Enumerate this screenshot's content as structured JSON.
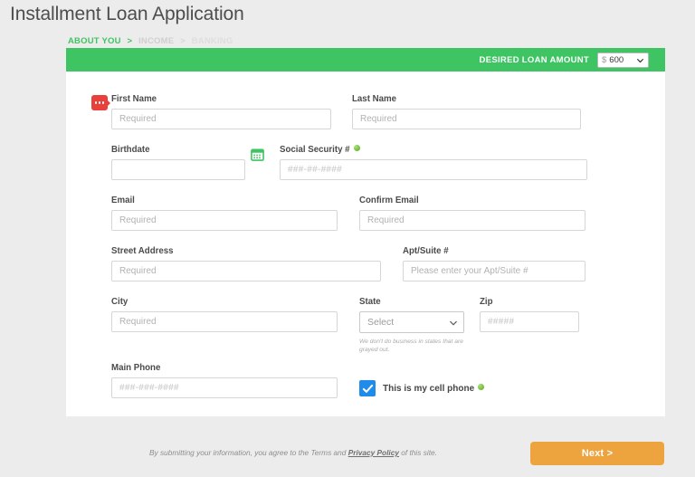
{
  "page": {
    "title": "Installment Loan Application",
    "background_color": "#ececec",
    "card_background": "#ffffff",
    "accent_green": "#3fc463",
    "accent_orange": "#eda43e",
    "accent_blue": "#1f8ceb",
    "accent_red": "#e8413c"
  },
  "breadcrumb": {
    "steps": [
      {
        "label": "ABOUT YOU",
        "state": "active"
      },
      {
        "label": "INCOME",
        "state": "inactive"
      },
      {
        "label": "BANKING",
        "state": "inactive"
      }
    ],
    "separator": ">"
  },
  "header_bar": {
    "label": "DESIRED LOAN AMOUNT",
    "amount_currency": "$",
    "amount_value": "600",
    "chevron_icon": "chevron-down-icon",
    "options": [
      "$ 600"
    ]
  },
  "form": {
    "first_name": {
      "label": "First Name",
      "placeholder": "Required",
      "value": "",
      "marker_icon": "required-tooltip-icon"
    },
    "last_name": {
      "label": "Last Name",
      "placeholder": "Required",
      "value": ""
    },
    "birthdate": {
      "label": "Birthdate",
      "placeholder": "",
      "value": "",
      "calendar_icon": "calendar-icon"
    },
    "social_security": {
      "label": "Social Security #",
      "placeholder": "###-##-####",
      "value": "",
      "help_icon": "help-dot-icon"
    },
    "email": {
      "label": "Email",
      "placeholder": "Required",
      "value": ""
    },
    "confirm_email": {
      "label": "Confirm Email",
      "placeholder": "Required",
      "value": ""
    },
    "street_address": {
      "label": "Street Address",
      "placeholder": "Required",
      "value": ""
    },
    "apt_suite": {
      "label": "Apt/Suite #",
      "placeholder": "Please enter your Apt/Suite #",
      "value": ""
    },
    "city": {
      "label": "City",
      "placeholder": "Required",
      "value": ""
    },
    "state": {
      "label": "State",
      "selected": "Select",
      "chevron_icon": "chevron-down-icon",
      "note": "We don't do business in states that are grayed out.",
      "options": [
        "Select"
      ]
    },
    "zip": {
      "label": "Zip",
      "placeholder": "#####",
      "value": ""
    },
    "main_phone": {
      "label": "Main Phone",
      "placeholder": "###-###-####",
      "value": ""
    },
    "cell_phone_checkbox": {
      "label": "This is my cell phone",
      "checked": true,
      "check_icon": "checkmark-icon",
      "help_icon": "help-dot-icon"
    }
  },
  "footer": {
    "legal_prefix": "By submitting your information, you agree to the Terms and ",
    "legal_link": "Privacy Policy",
    "legal_suffix": " of this site.",
    "next_label": "Next >"
  }
}
